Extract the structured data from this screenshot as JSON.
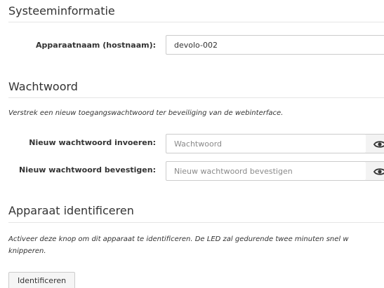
{
  "system_info": {
    "title": "Systeeminformatie",
    "device_name_label": "Apparaatnaam (hostnaam):",
    "device_name_value": "devolo-002"
  },
  "password": {
    "title": "Wachtwoord",
    "description": "Verstrek een nieuw toegangswachtwoord ter beveiliging van de webinterface.",
    "new_label": "Nieuw wachtwoord invoeren:",
    "new_placeholder": "Wachtwoord",
    "confirm_label": "Nieuw wachtwoord bevestigen:",
    "confirm_placeholder": "Nieuw wachtwoord bevestigen",
    "reveal_icon": "eye-icon"
  },
  "identify": {
    "title": "Apparaat identificeren",
    "description_line1": "Activeer deze knop om dit apparaat te identificeren. De LED zal gedurende twee minuten snel w",
    "description_line2": "knipperen.",
    "button_label": "Identificeren"
  }
}
